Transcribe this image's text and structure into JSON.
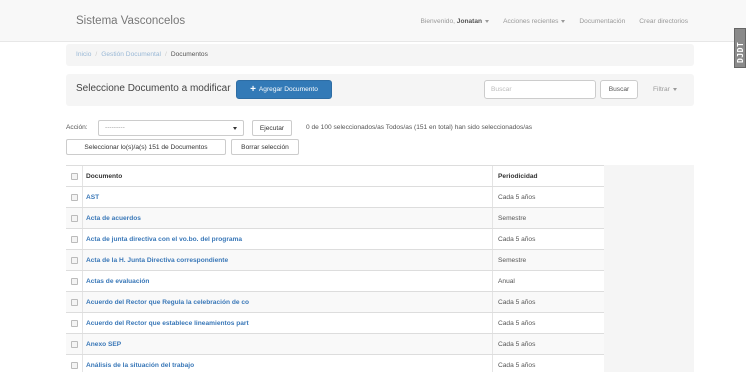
{
  "navbar": {
    "brand": "Sistema Vasconcelos",
    "welcome_prefix": "Bienvenido,",
    "user_name": "Jonatan",
    "recent_actions": "Acciones recientes",
    "documentation": "Documentación",
    "create_directories": "Crear directorios"
  },
  "side_badge": {
    "text": "DJDT"
  },
  "breadcrumb": {
    "items": [
      "Inicio",
      "Gestión Documental",
      "Documentos"
    ]
  },
  "header": {
    "title": "Seleccione Documento a modificar",
    "add_button": "Agregar Documento",
    "search_placeholder": "Buscar",
    "search_button": "Buscar",
    "filter": "Filtrar"
  },
  "actions": {
    "label": "Acción:",
    "select_value": "---------",
    "execute_button": "Ejecutar",
    "selection_info": "0 de 100 seleccionados/as Todos/as (151 en total) han sido seleccionados/as",
    "select_all_button": "Seleccionar lo(s)/a(s) 151 de Documentos",
    "clear_button": "Borrar selección"
  },
  "table": {
    "columns": [
      "Documento",
      "Periodicidad"
    ],
    "rows": [
      {
        "documento": "AST",
        "periodicidad": "Cada 5 años"
      },
      {
        "documento": "Acta de acuerdos",
        "periodicidad": "Semestre"
      },
      {
        "documento": "Acta de junta directiva con el vo.bo. del programa",
        "periodicidad": "Cada 5 años"
      },
      {
        "documento": "Acta de la H. Junta Directiva correspondiente",
        "periodicidad": "Semestre"
      },
      {
        "documento": "Actas de evaluación",
        "periodicidad": "Anual"
      },
      {
        "documento": "Acuerdo del Rector que Regula la celebración de co",
        "periodicidad": "Cada 5 años"
      },
      {
        "documento": "Acuerdo del Rector que establece lineamientos part",
        "periodicidad": "Cada 5 años"
      },
      {
        "documento": "Anexo SEP",
        "periodicidad": "Cada 5 años"
      },
      {
        "documento": "Análisis de la situación del trabajo",
        "periodicidad": "Cada 5 años"
      }
    ]
  }
}
